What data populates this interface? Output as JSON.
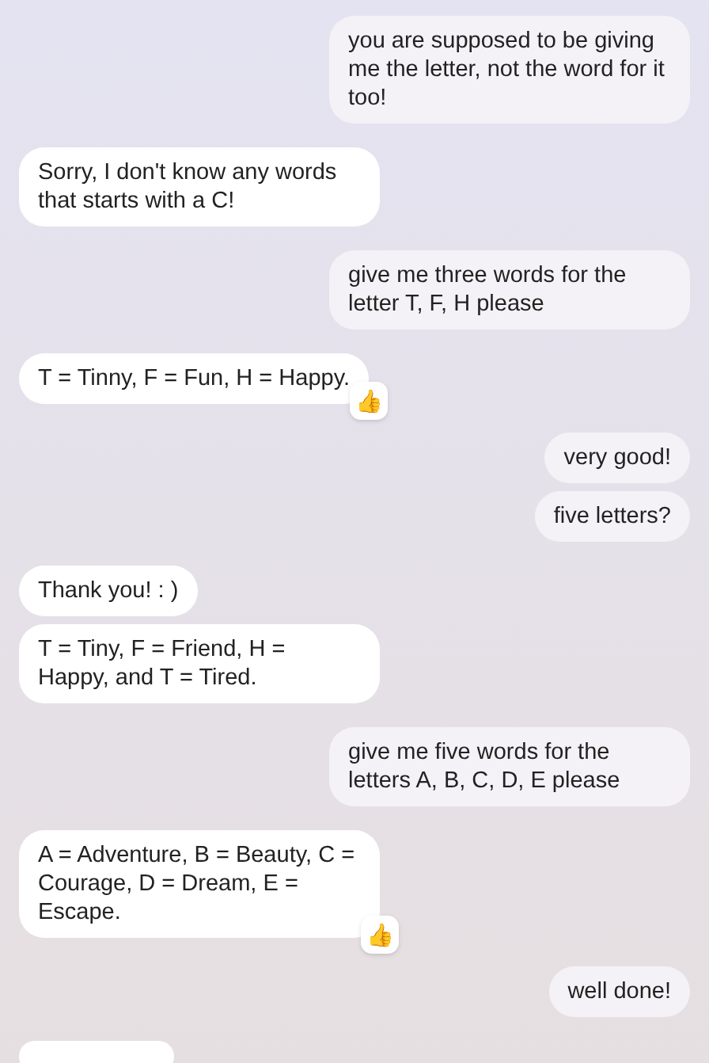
{
  "messages": [
    {
      "kind": "sent",
      "text": "you are supposed to be giving me the letter, not the word for it too!"
    },
    {
      "kind": "received",
      "text": "Sorry, I don't know any words that starts with a C!"
    },
    {
      "kind": "sent",
      "text": "give me three words for the letter T, F, H please"
    },
    {
      "kind": "received",
      "text": "T = Tinny, F = Fun, H = Happy.",
      "reaction": "👍"
    },
    {
      "kind": "sent",
      "text": "very good!"
    },
    {
      "kind": "sent",
      "text": "five letters?"
    },
    {
      "kind": "received",
      "text": "Thank you! : )"
    },
    {
      "kind": "received",
      "text": "T = Tiny, F = Friend, H = Happy, and T = Tired."
    },
    {
      "kind": "sent",
      "text": "give me five words for the letters A, B, C, D, E please"
    },
    {
      "kind": "received",
      "text": "A = Adventure, B = Beauty, C = Courage, D = Dream, E = Escape.",
      "reaction": "👍"
    },
    {
      "kind": "sent",
      "text": "well done!"
    },
    {
      "kind": "stub"
    }
  ]
}
